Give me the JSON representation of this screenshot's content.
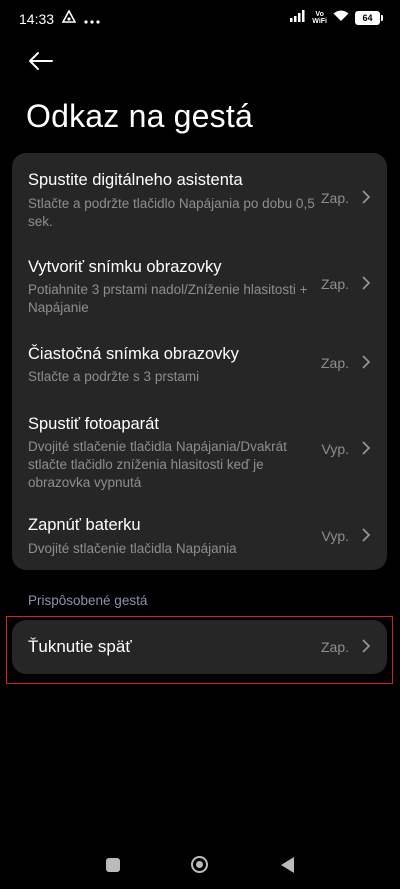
{
  "status_bar": {
    "time": "14:33",
    "volte": "Vo",
    "wifi_label": "WiFi",
    "battery": "64"
  },
  "page": {
    "title": "Odkaz na gestá"
  },
  "gestures": [
    {
      "title": "Spustite digitálneho asistenta",
      "subtitle": "Stlačte a podržte tlačidlo Napájania po dobu 0,5 sek.",
      "value": "Zap."
    },
    {
      "title": "Vytvoriť snímku obrazovky",
      "subtitle": "Potiahnite 3 prstami nadol/Zníženie hlasitosti + Napájanie",
      "value": "Zap."
    },
    {
      "title": "Čiastočná snímka obrazovky",
      "subtitle": "Stlačte a podržte s 3 prstami",
      "value": "Zap."
    },
    {
      "title": "Spustiť fotoaparát",
      "subtitle": "Dvojité stlačenie tlačidla Napájania/Dvakrát stlačte tlačidlo zníženia hlasitosti keď je obrazovka vypnutá",
      "value": "Vyp."
    },
    {
      "title": "Zapnúť baterku",
      "subtitle": "Dvojité stlačenie tlačidla Napájania",
      "value": "Vyp."
    }
  ],
  "custom_section": {
    "header": "Prispôsobené gestá",
    "items": [
      {
        "title": "Ťuknutie späť",
        "value": "Zap."
      }
    ]
  },
  "colors": {
    "background": "#000000",
    "card": "#262626",
    "secondary_text": "#8e8e8e",
    "section_header": "#8a93b0",
    "highlight": "#d2232a"
  }
}
